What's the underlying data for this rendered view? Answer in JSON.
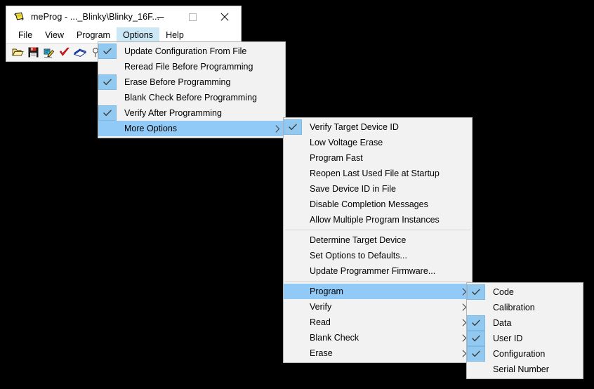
{
  "window": {
    "title": "meProg - ..._Blinky\\Blinky_16F...",
    "app_icon": "chip-icon",
    "minimize_label": "—",
    "maximize_label": "☐",
    "close_label": "✕"
  },
  "menubar": {
    "items": [
      {
        "label": "File",
        "active": false
      },
      {
        "label": "View",
        "active": false
      },
      {
        "label": "Program",
        "active": false
      },
      {
        "label": "Options",
        "active": true
      },
      {
        "label": "Help",
        "active": false
      }
    ]
  },
  "toolbar": {
    "buttons": [
      {
        "name": "open-file-icon",
        "title": "Open"
      },
      {
        "name": "save-file-icon",
        "title": "Save"
      },
      {
        "name": "program-write-icon",
        "title": "Program"
      },
      {
        "name": "verify-check-icon",
        "title": "Verify"
      },
      {
        "name": "erase-icon",
        "title": "Erase"
      },
      {
        "name": "blank-check-icon",
        "title": "Blank Check"
      }
    ]
  },
  "menu_options": {
    "name": "options-menu",
    "items": [
      {
        "label": "Update Configuration From File",
        "checked": true,
        "selected": false,
        "submenu": false
      },
      {
        "label": "Reread File Before Programming",
        "checked": false,
        "selected": false,
        "submenu": false
      },
      {
        "label": "Erase Before Programming",
        "checked": true,
        "selected": false,
        "submenu": false
      },
      {
        "label": "Blank Check Before Programming",
        "checked": false,
        "selected": false,
        "submenu": false
      },
      {
        "label": "Verify After Programming",
        "checked": true,
        "selected": false,
        "submenu": false
      },
      {
        "label": "More Options",
        "checked": false,
        "selected": true,
        "submenu": true
      }
    ]
  },
  "menu_more_options": {
    "name": "more-options-submenu",
    "items": [
      {
        "label": "Verify Target Device ID",
        "checked": true,
        "selected": false,
        "submenu": false,
        "separator_before": false
      },
      {
        "label": "Low Voltage Erase",
        "checked": false,
        "selected": false,
        "submenu": false,
        "separator_before": false
      },
      {
        "label": "Program Fast",
        "checked": false,
        "selected": false,
        "submenu": false,
        "separator_before": false
      },
      {
        "label": "Reopen Last Used File at Startup",
        "checked": false,
        "selected": false,
        "submenu": false,
        "separator_before": false
      },
      {
        "label": "Save Device ID in File",
        "checked": false,
        "selected": false,
        "submenu": false,
        "separator_before": false
      },
      {
        "label": "Disable Completion Messages",
        "checked": false,
        "selected": false,
        "submenu": false,
        "separator_before": false
      },
      {
        "label": "Allow Multiple Program Instances",
        "checked": false,
        "selected": false,
        "submenu": false,
        "separator_before": false
      },
      {
        "label": "Determine Target Device",
        "checked": false,
        "selected": false,
        "submenu": false,
        "separator_before": true
      },
      {
        "label": "Set Options to Defaults...",
        "checked": false,
        "selected": false,
        "submenu": false,
        "separator_before": false
      },
      {
        "label": "Update Programmer Firmware...",
        "checked": false,
        "selected": false,
        "submenu": false,
        "separator_before": false
      },
      {
        "label": "Program",
        "checked": false,
        "selected": true,
        "submenu": true,
        "separator_before": true
      },
      {
        "label": "Verify",
        "checked": false,
        "selected": false,
        "submenu": true,
        "separator_before": false
      },
      {
        "label": "Read",
        "checked": false,
        "selected": false,
        "submenu": true,
        "separator_before": false
      },
      {
        "label": "Blank Check",
        "checked": false,
        "selected": false,
        "submenu": true,
        "separator_before": false
      },
      {
        "label": "Erase",
        "checked": false,
        "selected": false,
        "submenu": true,
        "separator_before": false
      }
    ]
  },
  "menu_program": {
    "name": "program-submenu",
    "items": [
      {
        "label": "Code",
        "checked": true,
        "selected": false,
        "submenu": false
      },
      {
        "label": "Calibration",
        "checked": false,
        "selected": false,
        "submenu": false
      },
      {
        "label": "Data",
        "checked": true,
        "selected": false,
        "submenu": false
      },
      {
        "label": "User ID",
        "checked": true,
        "selected": false,
        "submenu": false
      },
      {
        "label": "Configuration",
        "checked": true,
        "selected": false,
        "submenu": false
      },
      {
        "label": "Serial Number",
        "checked": false,
        "selected": false,
        "submenu": false
      }
    ]
  },
  "colors": {
    "selection_blue": "#91c9f7",
    "check_box_blue": "#91c9f0",
    "menubar_active": "#cce8f7",
    "menu_bg": "#f2f2f2",
    "desktop": "#000000"
  }
}
